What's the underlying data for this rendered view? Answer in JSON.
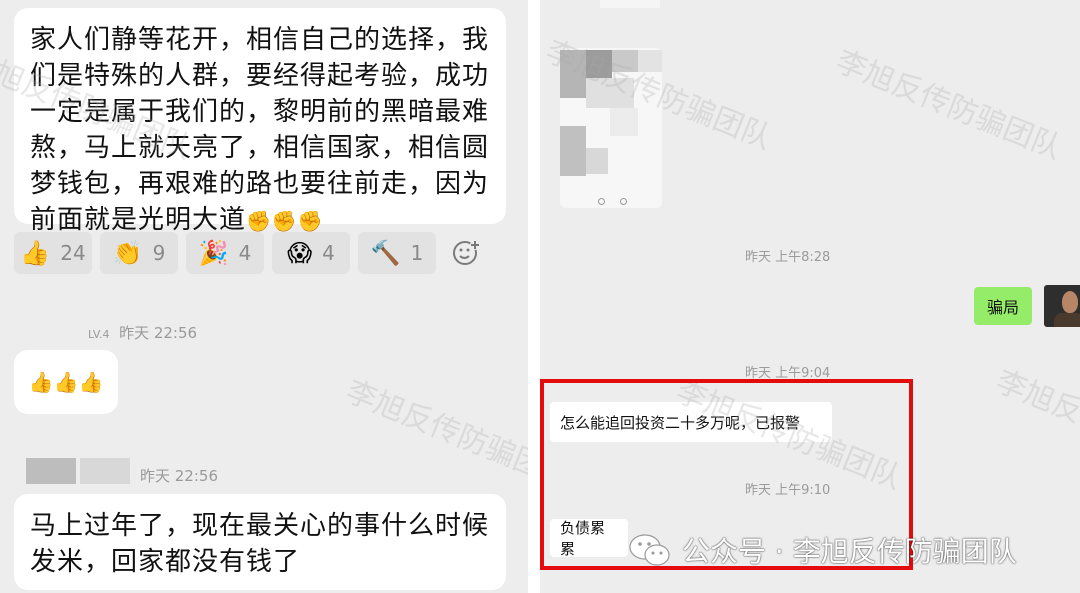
{
  "left_chat": {
    "messages": [
      {
        "text": "家人们静等花开，相信自己的选择，我们是特殊的人群，要经得起考验，成功一定是属于我们的，黎明前的黑暗最难熬，马上就天亮了，相信国家，相信圆梦钱包，再艰难的路也要往前走，因为前面就是光明大道"
      },
      {
        "text": "马上过年了，现在最关心的事什么时候发米，回家都没有钱了"
      }
    ],
    "reactions": [
      {
        "emoji": "👍",
        "count": "24"
      },
      {
        "emoji": "👏",
        "count": "9"
      },
      {
        "emoji": "🎉",
        "count": "4"
      },
      {
        "emoji": "😱",
        "count": "4"
      },
      {
        "emoji": "🔨",
        "count": "1"
      }
    ],
    "add_reaction_icon": "smiley-plus-icon",
    "first_sender_level": "LV.4",
    "first_time": "昨天 22:56",
    "second_time": "昨天 22:56",
    "thumbs_msg": "👍👍👍",
    "message_emojis": "✊✊✊"
  },
  "right_chat": {
    "time_1": "昨天 上午8:28",
    "outgoing_message": "骗局",
    "time_2": "昨天 上午9:04",
    "incoming_message_1": "怎么能追回投资二十多万呢，已报警",
    "time_3": "昨天 上午9:10",
    "incoming_message_2": "负债累累"
  },
  "watermark": "李旭反传防骗团队",
  "footer": {
    "text": "公众号 · 李旭反传防骗团队",
    "icon": "wechat-icon"
  },
  "colors": {
    "chat_bg": "#ededed",
    "green_bubble": "#95ec69",
    "highlight": "#e30c0c"
  }
}
